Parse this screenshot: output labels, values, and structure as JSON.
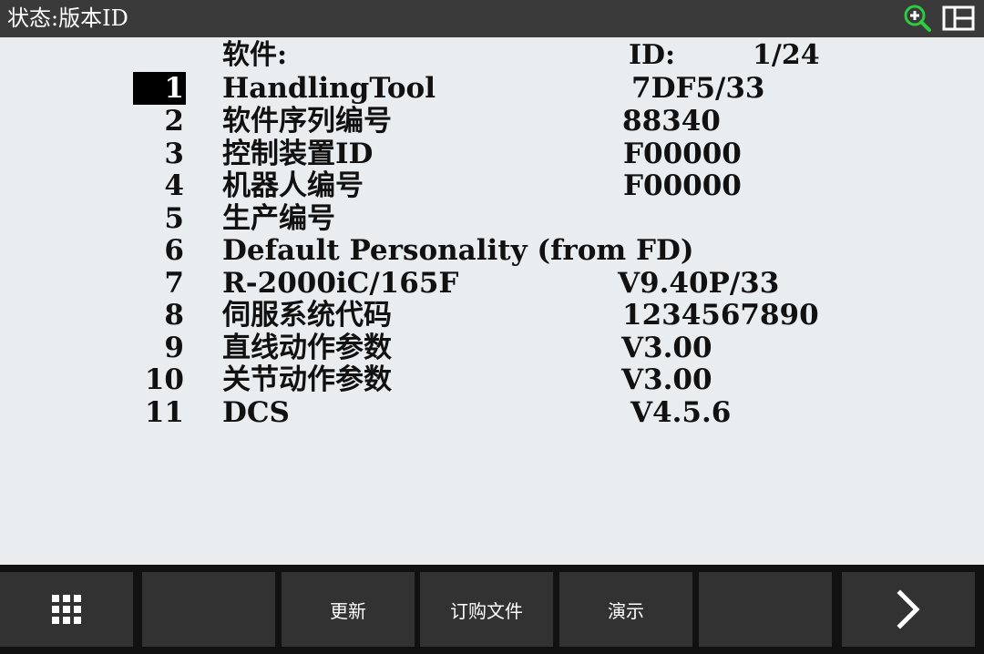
{
  "titlebar": {
    "title": "状态:版本ID",
    "zoom_icon": "zoom-in-icon",
    "layout_icon": "split-layout-icon",
    "zoom_color": "#2ecc40"
  },
  "header": {
    "software_label": "软件:",
    "id_label": "ID:",
    "page": "1/24"
  },
  "rows": [
    {
      "num": "1",
      "name": "HandlingTool",
      "value": "7DF5/33"
    },
    {
      "num": "2",
      "name": "软件序列编号",
      "value": "88340"
    },
    {
      "num": "3",
      "name": "控制装置ID",
      "value": "F00000"
    },
    {
      "num": "4",
      "name": "机器人编号",
      "value": "F00000"
    },
    {
      "num": "5",
      "name": "生产编号",
      "value": ""
    },
    {
      "num": "6",
      "name": "Default Personality (from FD)",
      "value": ""
    },
    {
      "num": "7",
      "name": "R-2000iC/165F",
      "value": "V9.40P/33"
    },
    {
      "num": "8",
      "name": "伺服系统代码",
      "value": "1234567890"
    },
    {
      "num": "9",
      "name": "直线动作参数",
      "value": "V3.00"
    },
    {
      "num": "10",
      "name": "关节动作参数",
      "value": "V3.00"
    },
    {
      "num": "11",
      "name": "DCS",
      "value": "V4.5.6"
    }
  ],
  "toolbar": {
    "menu_icon": "grid-menu-icon",
    "btn2": "",
    "update": "更新",
    "order_file": "订购文件",
    "demo": "演示",
    "btn6": "",
    "next_icon": "chevron-right-icon"
  }
}
